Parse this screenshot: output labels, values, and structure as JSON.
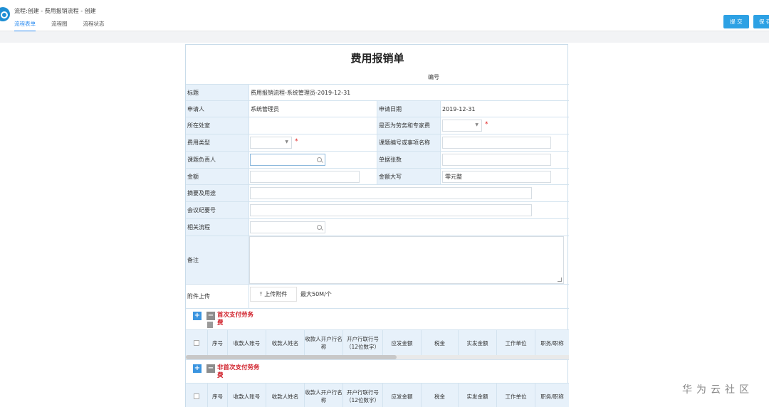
{
  "header": {
    "breadcrumb": "流程:创建 - 费用报销流程 - 创建",
    "tabs": [
      {
        "label": "流程表单",
        "active": true
      },
      {
        "label": "流程图",
        "active": false
      },
      {
        "label": "流程状态",
        "active": false
      }
    ],
    "buttons": [
      "提 交",
      "保 存"
    ]
  },
  "form": {
    "title": "费用报销单",
    "serial_label": "编号",
    "fields": {
      "title_label": "标题",
      "title_value": "费用报销流程-系统管理员-2019-12-31",
      "applicant_label": "申请人",
      "applicant_value": "系统管理员",
      "apply_date_label": "申请日期",
      "apply_date_value": "2019-12-31",
      "dept_label": "所在处室",
      "is_labor_label": "是否为劳务和专家费",
      "fee_type_label": "费用类型",
      "project_no_label": "课题编号或事项名称",
      "project_leader_label": "课题负责人",
      "receipt_count_label": "单据张数",
      "amount_label": "金额",
      "amount_upper_label": "金额大写",
      "amount_upper_value": "零元整",
      "summary_label": "摘要及用途",
      "meeting_label": "会议纪要号",
      "related_flow_label": "相关流程",
      "remark_label": "备注",
      "attach_label": "附件上传",
      "upload_button": "上传附件",
      "upload_hint": "最大50M/个"
    },
    "required_mark": "*"
  },
  "sections": [
    {
      "title": "首次支付劳务费",
      "add_icon": "plus-icon",
      "remove_icon": "minus-icon",
      "columns": [
        "序号",
        "收款人账号",
        "收款人姓名",
        "收款人开户行名称",
        "开户行联行号（12位数字）",
        "应发金额",
        "税金",
        "实发金额",
        "工作单位",
        "职务/职称"
      ]
    },
    {
      "title": "非首次支付劳务费",
      "add_icon": "plus-icon",
      "remove_icon": "minus-icon",
      "columns": [
        "序号",
        "收款人账号",
        "收款人姓名",
        "收款人开户行名称",
        "开户行联行号（12位数字）",
        "应发金额",
        "税金",
        "实发金额",
        "工作单位",
        "职务/职称"
      ]
    }
  ],
  "watermark": "华为云社区",
  "colors": {
    "accent": "#2d8cf0",
    "button": "#2da1e4",
    "label_bg": "#e7f1fa",
    "required": "#e02020",
    "section_title": "#d0202a"
  }
}
